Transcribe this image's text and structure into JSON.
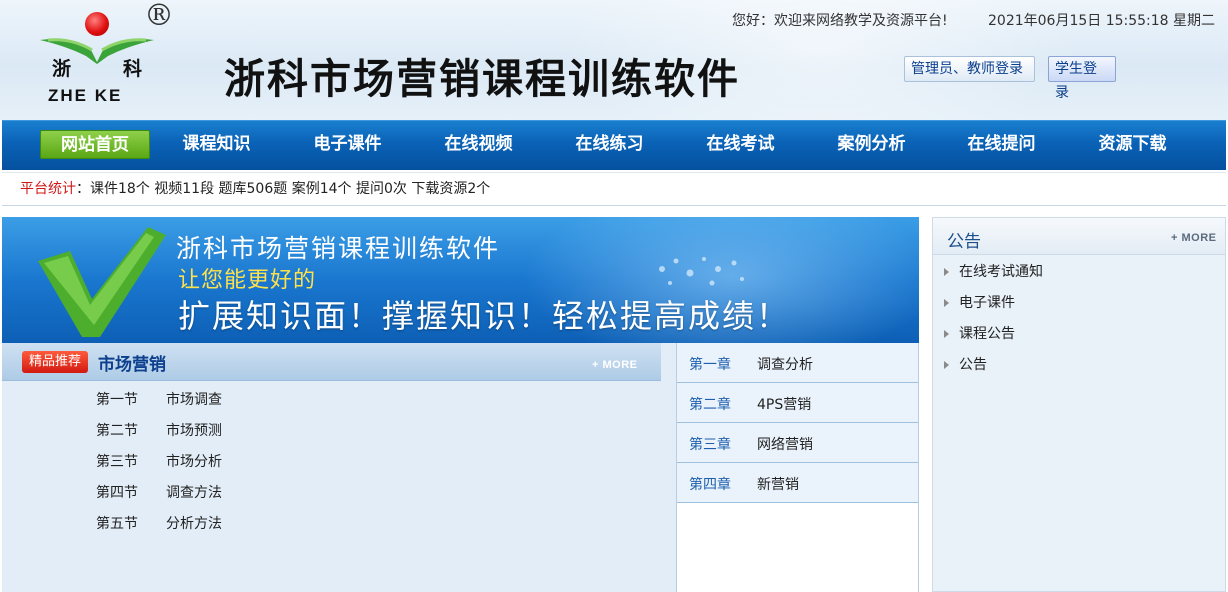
{
  "header": {
    "logo": {
      "reg_mark": "®",
      "cn_left": "浙",
      "cn_right": "科",
      "en": "ZHE KE"
    },
    "site_title": "浙科市场营销课程训练软件",
    "welcome": "您好：欢迎来网络教学及资源平台!",
    "datetime": "2021年06月15日 15:55:18 星期二",
    "login_admin": "管理员、教师登录",
    "login_student": "学生登录"
  },
  "nav": {
    "items": [
      {
        "label": "网站首页",
        "active": true
      },
      {
        "label": "课程知识"
      },
      {
        "label": "电子课件"
      },
      {
        "label": "在线视频"
      },
      {
        "label": "在线练习"
      },
      {
        "label": "在线考试"
      },
      {
        "label": "案例分析"
      },
      {
        "label": "在线提问"
      },
      {
        "label": "资源下载"
      }
    ]
  },
  "stats": {
    "label": "平台统计",
    "text": "：课件18个 视频11段 题库506题 案例14个 提问0次 下载资源2个"
  },
  "banner": {
    "line1": "浙科市场营销课程训练软件",
    "line2": "让您能更好的",
    "line3": "扩展知识面！撑握知识！轻松提高成绩！"
  },
  "section": {
    "badge": "精品推荐",
    "title": "市场营销",
    "more": "+ MORE",
    "lessons": [
      {
        "num": "第一节",
        "title": "市场调查"
      },
      {
        "num": "第二节",
        "title": "市场预测"
      },
      {
        "num": "第三节",
        "title": "市场分析"
      },
      {
        "num": "第四节",
        "title": "调查方法"
      },
      {
        "num": "第五节",
        "title": "分析方法"
      }
    ]
  },
  "chapters": [
    {
      "num": "第一章",
      "title": "调查分析"
    },
    {
      "num": "第二章",
      "title": "4PS营销"
    },
    {
      "num": "第三章",
      "title": "网络营销"
    },
    {
      "num": "第四章",
      "title": "新营销"
    }
  ],
  "notice": {
    "title": "公告",
    "more": "+ MORE",
    "items": [
      "在线考试通知",
      "电子课件",
      "课程公告",
      "公告"
    ]
  },
  "colors": {
    "nav_blue": "#0a62b6",
    "nav_active_green": "#6cb823",
    "stats_label_red": "#d01818",
    "badge_red": "#d11a10",
    "section_title_blue": "#0c3f8e"
  }
}
